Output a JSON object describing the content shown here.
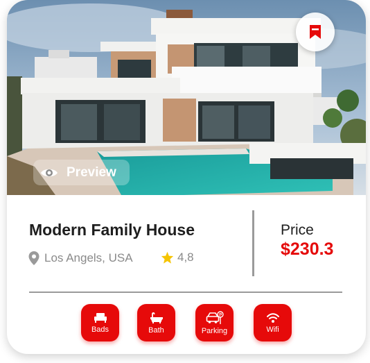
{
  "listing": {
    "title": "Modern Family House",
    "location": "Los Angels, USA",
    "rating": "4,8"
  },
  "price": {
    "label": "Price",
    "value": "$230.3"
  },
  "photo": {
    "preview_label": "Preview"
  },
  "amenities": [
    {
      "label": "Bads",
      "icon": "bed-icon"
    },
    {
      "label": "Bath",
      "icon": "bathtub-icon"
    },
    {
      "label": "Parking",
      "icon": "parking-icon"
    },
    {
      "label": "Wifi",
      "icon": "wifi-icon"
    }
  ],
  "colors": {
    "accent": "#e60a0a",
    "text": "#1e1e1e",
    "muted": "#8a8a8a",
    "star": "#f5c400"
  }
}
